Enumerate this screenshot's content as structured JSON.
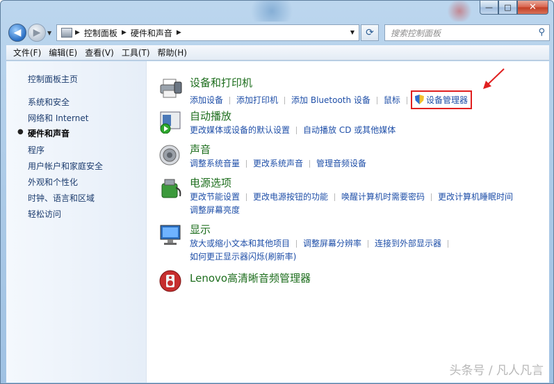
{
  "window": {
    "minimize_glyph": "—",
    "maximize_glyph": "□",
    "close_glyph": "✕"
  },
  "nav": {
    "back_glyph": "◀",
    "forward_glyph": "▶",
    "breadcrumb": [
      "控制面板",
      "硬件和声音"
    ],
    "search_placeholder": "搜索控制面板"
  },
  "menu": [
    "文件(F)",
    "编辑(E)",
    "查看(V)",
    "工具(T)",
    "帮助(H)"
  ],
  "sidebar": {
    "home": "控制面板主页",
    "items": [
      "系统和安全",
      "网络和 Internet",
      "硬件和声音",
      "程序",
      "用户帐户和家庭安全",
      "外观和个性化",
      "时钟、语言和区域",
      "轻松访问"
    ],
    "active_index": 2
  },
  "categories": [
    {
      "title": "设备和打印机",
      "icon": "printer-icon",
      "links": [
        "添加设备",
        "添加打印机",
        "添加 Bluetooth 设备",
        "鼠标",
        "设备管理器"
      ]
    },
    {
      "title": "自动播放",
      "icon": "autoplay-icon",
      "links": [
        "更改媒体或设备的默认设置",
        "自动播放 CD 或其他媒体"
      ]
    },
    {
      "title": "声音",
      "icon": "speaker-icon",
      "links": [
        "调整系统音量",
        "更改系统声音",
        "管理音频设备"
      ]
    },
    {
      "title": "电源选项",
      "icon": "power-icon",
      "links": [
        "更改节能设置",
        "更改电源按钮的功能",
        "唤醒计算机时需要密码",
        "更改计算机睡眠时间"
      ],
      "links2": [
        "调整屏幕亮度"
      ]
    },
    {
      "title": "显示",
      "icon": "display-icon",
      "links": [
        "放大或缩小文本和其他项目",
        "调整屏幕分辨率",
        "连接到外部显示器"
      ],
      "links2": [
        "如何更正显示器闪烁(刷新率)"
      ]
    },
    {
      "title": "Lenovo高清晰音频管理器",
      "icon": "audio-manager-icon",
      "links": []
    }
  ],
  "watermark": "头条号 / 凡人凡言",
  "colors": {
    "link": "#1f4fa8",
    "category_title": "#1e6e1e",
    "highlight": "#e02020"
  }
}
